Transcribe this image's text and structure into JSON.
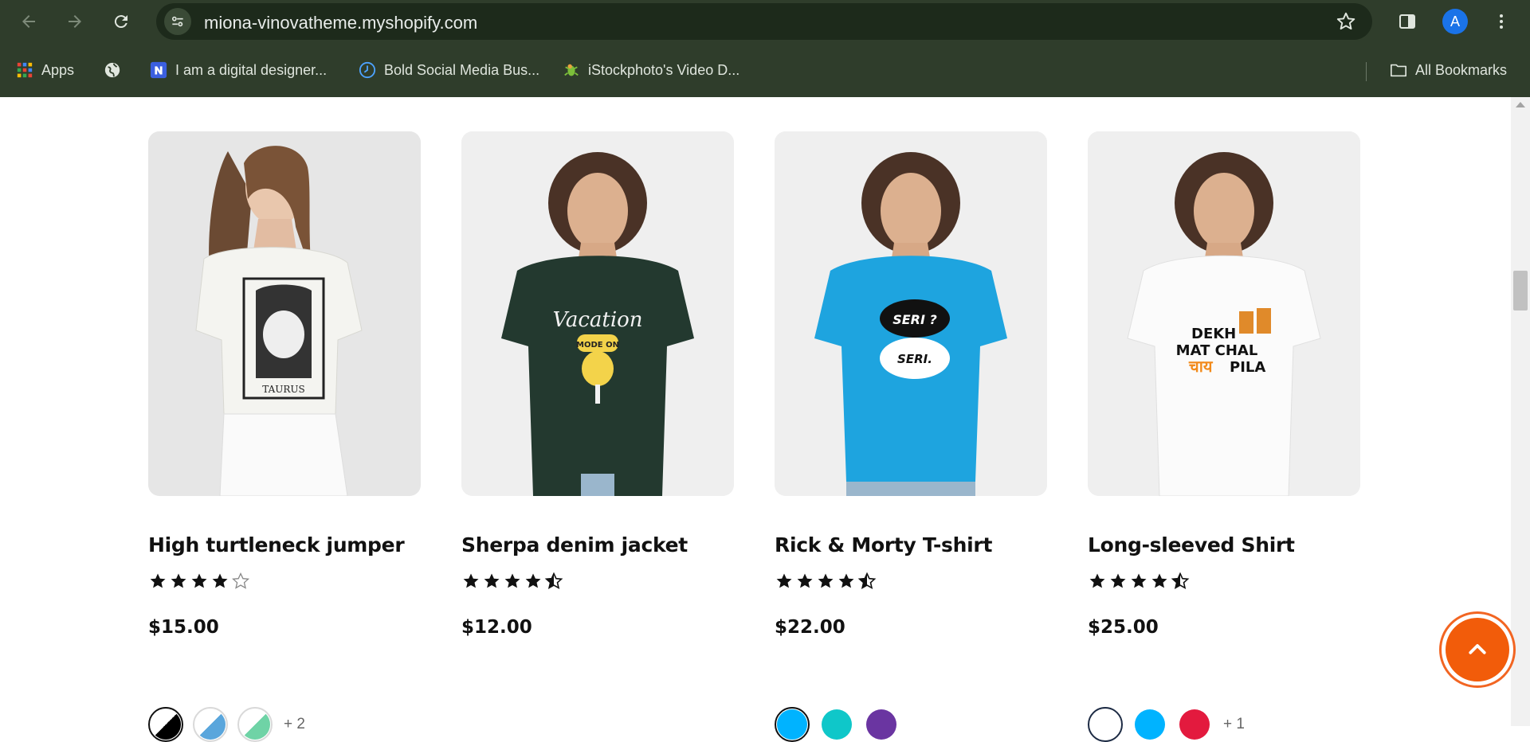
{
  "browser": {
    "url": "miona-vinovatheme.myshopify.com",
    "avatar_letter": "A",
    "bookmarks": [
      {
        "label": "Apps",
        "icon": "apps-grid-icon"
      },
      {
        "label": "",
        "icon": "globe-icon"
      },
      {
        "label": "I am a digital designer...",
        "icon": "n-logo-icon"
      },
      {
        "label": "Bold Social Media Bus...",
        "icon": "clock-icon"
      },
      {
        "label": "iStockphoto's Video D...",
        "icon": "gecko-icon"
      }
    ],
    "all_bookmarks": "All Bookmarks"
  },
  "products": [
    {
      "title": "High turtleneck jumper",
      "rating": 4.0,
      "price": "$15.00",
      "shirt_color": "#f4f4f0",
      "graphic": "TAURUS",
      "swatches": [
        "#000000/#ffffff",
        "#ffffff/#5aa6dc",
        "#ffffff/#6fd3a6"
      ],
      "swatch_active": 0,
      "more": "+ 2"
    },
    {
      "title": "Sherpa denim jacket",
      "rating": 4.5,
      "price": "$12.00",
      "shirt_color": "#23392f",
      "graphic": "Vacation MODE ON",
      "swatches": [],
      "swatch_active": -1,
      "more": ""
    },
    {
      "title": "Rick & Morty T-shirt",
      "rating": 4.5,
      "price": "$22.00",
      "shirt_color": "#1ea4df",
      "graphic": "SERI? SERI.",
      "swatches": [
        "#00b3ff",
        "#0fc7c9",
        "#6a35a1"
      ],
      "swatch_active": 0,
      "more": ""
    },
    {
      "title": "Long-sleeved Shirt",
      "rating": 4.5,
      "price": "$25.00",
      "shirt_color": "#fbfbfb",
      "graphic": "DEKH MAT CHAL चाय PILA",
      "swatches": [
        "#ffffff",
        "#00b3ff",
        "#e31a3e"
      ],
      "swatch_active": 0,
      "more": "+ 1"
    }
  ],
  "colors": {
    "chrome_bg": "#2f3d2b",
    "accent_orange": "#f25c0a"
  }
}
